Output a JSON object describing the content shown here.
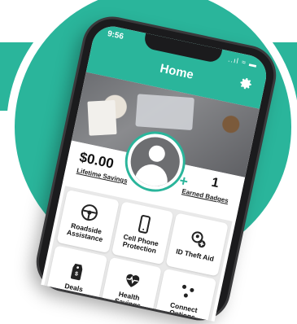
{
  "status_bar": {
    "time": "9:56",
    "icons": "..ıl ≈ ▬"
  },
  "header": {
    "title": "Home"
  },
  "profile": {
    "add_symbol": "+"
  },
  "stats": {
    "savings_value": "$0.00",
    "savings_label": "Lifetime Savings",
    "badges_value": "1",
    "badges_label": "Earned Badges"
  },
  "tiles": [
    {
      "label": "Roadside Assistance",
      "icon": "steering-wheel-icon"
    },
    {
      "label": "Cell Phone Protection",
      "icon": "smartphone-icon"
    },
    {
      "label": "ID Theft Aid",
      "icon": "id-theft-icon"
    },
    {
      "label": "Deals",
      "icon": "price-tag-icon"
    },
    {
      "label": "Health Savings",
      "icon": "heart-pulse-icon"
    },
    {
      "label": "Connect Options",
      "icon": "connect-dots-icon"
    }
  ],
  "colors": {
    "brand": "#2ab59b",
    "dark": "#1b1b1d",
    "avatar": "#6d6e71"
  }
}
